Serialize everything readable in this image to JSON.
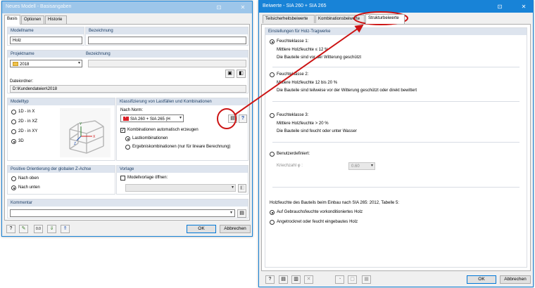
{
  "left_dialog": {
    "title": "Neues Modell - Basisangaben",
    "tabs": [
      "Basis",
      "Optionen",
      "Historie"
    ],
    "modellname": {
      "label": "Modellname",
      "value": "Holz"
    },
    "bezeichnung1": {
      "label": "Bezeichnung",
      "value": ""
    },
    "projektname": {
      "label": "Projektname",
      "value": "2018"
    },
    "bezeichnung2": {
      "label": "Bezeichnung",
      "value": ""
    },
    "dateiordner": {
      "label": "Dateiordner:",
      "value": "D:\\Kundendateien\\2018"
    },
    "modelltyp": {
      "header": "Modelltyp",
      "options": [
        "1D - in X",
        "2D - in XZ",
        "2D - in XY",
        "3D"
      ],
      "selected": 3
    },
    "klassifizierung": {
      "header": "Klassifizierung von Lastfällen und Kombinationen",
      "norm_label": "Nach Norm:",
      "norm_value": "SIA 260 + SIA 265 (H",
      "auto_label": "Kombinationen automatisch erzeugen",
      "auto_checked": true,
      "options": [
        "Lastkombinationen",
        "Ergebniskombinationen (nur für lineare Berechnung)"
      ],
      "selected": 0
    },
    "orientierung": {
      "header": "Positive Orientierung der globalen Z-Achse",
      "options": [
        "Nach oben",
        "Nach unten"
      ],
      "selected": 1
    },
    "vorlage": {
      "header": "Vorlage",
      "label": "Modellvorlage öffnen:",
      "checked": false
    },
    "kommentar": {
      "header": "Kommentar",
      "value": ""
    },
    "ok_label": "OK",
    "cancel_label": "Abbrechen"
  },
  "right_dialog": {
    "title": "Beiwerte - SIA 260 + SIA 265",
    "tabs": [
      "Teilsicherheitsbeiwerte",
      "Kombinationsbeiwerte",
      "Strukturbeiwerte"
    ],
    "group_header": "Einstellungen für Holz-Tragwerke",
    "classes": [
      {
        "title": "Feuchteklasse 1:",
        "line1": "Mittlere Holzfeuchte ≤ 12 %",
        "line2": "Die Bauteile sind vor der Witterung geschützt"
      },
      {
        "title": "Feuchteklasse 2:",
        "line1": "Mittlere Holzfeuchte 12 bis 20 %",
        "line2": "Die Bauteile sind teilweise vor der Witterung geschützt oder direkt bewittert"
      },
      {
        "title": "Feuchteklasse 3:",
        "line1": "Mittlere Holzfeuchte > 20 %",
        "line2": "Die Bauteile sind feucht oder unter Wasser"
      }
    ],
    "selected_class": 0,
    "benutzer_label": "Benutzerdefiniert:",
    "kriech_label": "Kriechzahl φ :",
    "kriech_value": "0.60",
    "holzfeuchte_text": "Holzfeuchte des Bauteils beim Einbau nach SIA 265: 2012, Tabelle 5:",
    "holz_options": [
      "Auf Gebrauchsfeuchte vorkonditioniertes Holz",
      "Angetrocknet oder feucht eingebautes Holz"
    ],
    "holz_selected": 0,
    "ok_label": "OK",
    "cancel_label": "Abbrechen"
  },
  "annotation_color": "#cc1414"
}
